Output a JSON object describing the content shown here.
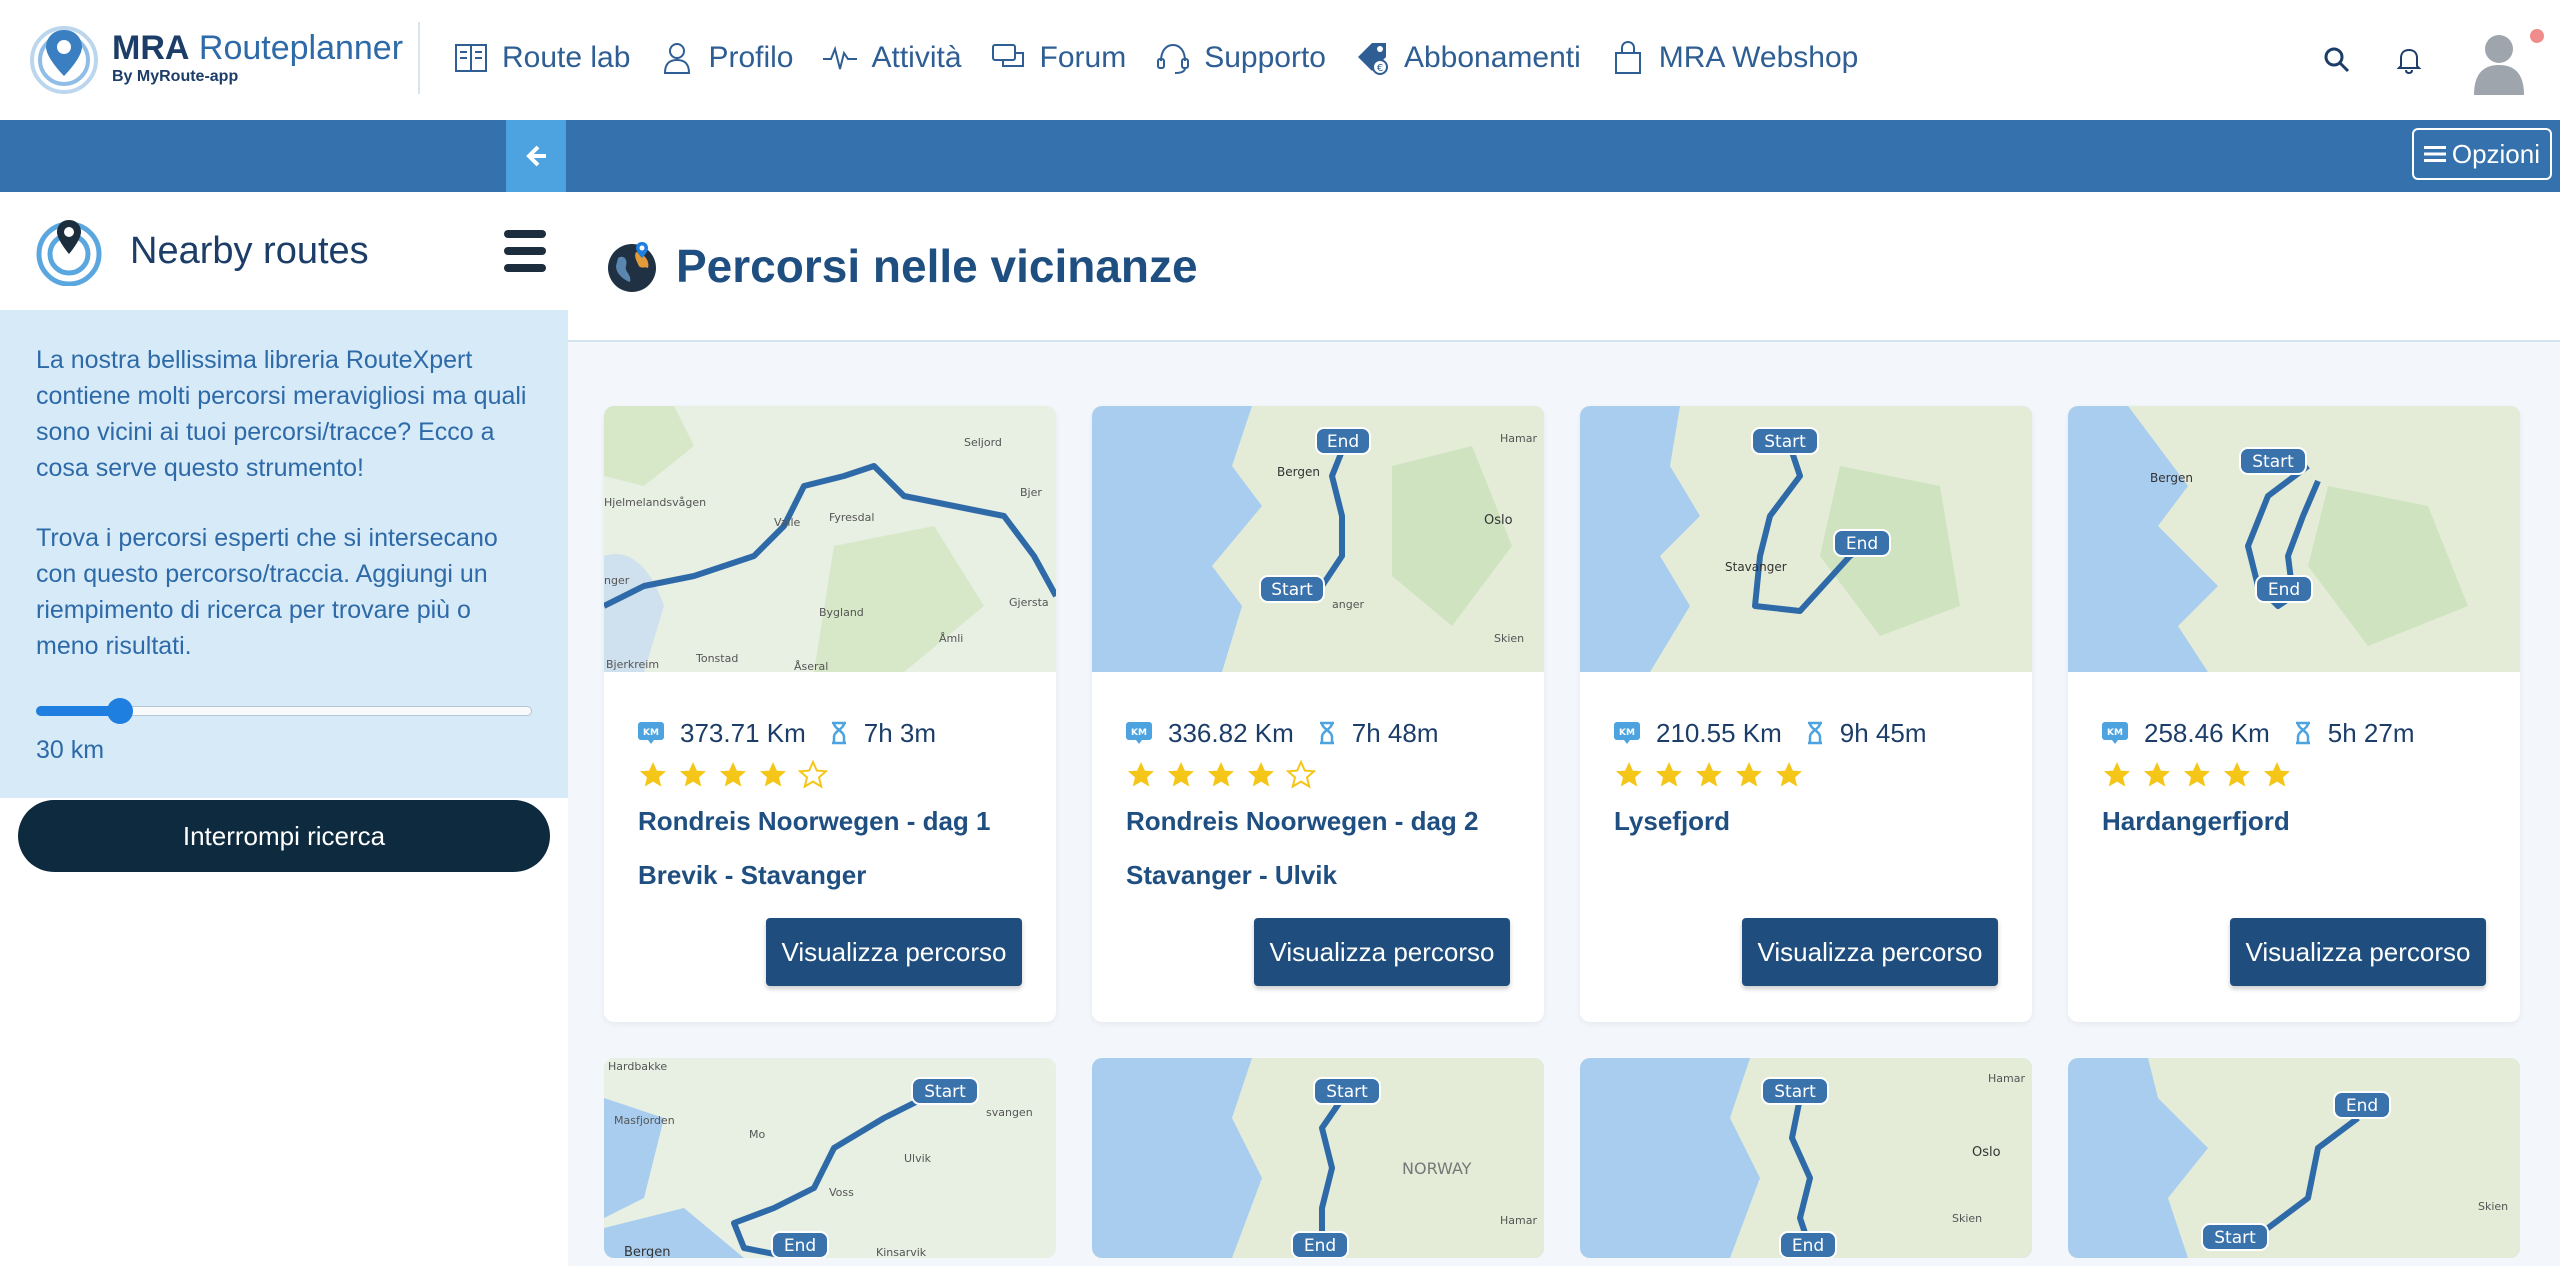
{
  "brand": {
    "name_bold": "MRA",
    "name_rest": " Routeplanner",
    "sub_prefix": "By MyRoute-",
    "sub_bold": "app"
  },
  "nav": [
    {
      "label": "Route lab",
      "icon": "map-book-icon"
    },
    {
      "label": "Profilo",
      "icon": "user-icon"
    },
    {
      "label": "Attività",
      "icon": "pulse-icon"
    },
    {
      "label": "Forum",
      "icon": "chat-icon"
    },
    {
      "label": "Supporto",
      "icon": "headset-icon"
    },
    {
      "label": "Abbonamenti",
      "icon": "tag-icon"
    },
    {
      "label": "MRA Webshop",
      "icon": "shopping-bag-icon"
    }
  ],
  "toolbar": {
    "options_label": "Opzioni"
  },
  "sidebar": {
    "title": "Nearby routes",
    "paragraph1": "La nostra bellissima libreria RouteXpert contiene molti percorsi meravigliosi ma quali sono vicini ai tuoi percorsi/tracce? Ecco a cosa serve questo strumento!",
    "paragraph2": "Trova i percorsi esperti che si intersecano con questo percorso/traccia. Aggiungi un riempimento di ricerca per trovare più o meno risultati.",
    "slider_value_label": "30 km",
    "slider_fraction": 0.17,
    "stop_button": "Interrompi ricerca"
  },
  "main": {
    "title": "Percorsi nelle vicinanze",
    "view_button": "Visualizza percorso"
  },
  "routes": [
    {
      "distance": "373.71 Km",
      "duration": "7h 3m",
      "rating": 4,
      "name1": "Rondreis Noorwegen - dag 1",
      "name2": "Brevik - Stavanger",
      "map_labels": [
        "Seljord",
        "Hjelmelandsvågen",
        "Valle",
        "Fyresdal",
        "Bjer",
        "Bygland",
        "Gjersta",
        "Åmli",
        "Bjerkreim",
        "Tonstad",
        "Åseral",
        "nger"
      ]
    },
    {
      "distance": "336.82 Km",
      "duration": "7h 48m",
      "rating": 4,
      "name1": "Rondreis Noorwegen - dag 2",
      "name2": "Stavanger - Ulvik",
      "map_labels": [
        "Bergen",
        "Hamar",
        "Oslo",
        "anger",
        "Skien"
      ],
      "start": "Start",
      "end": "End"
    },
    {
      "distance": "210.55 Km",
      "duration": "9h 45m",
      "rating": 5,
      "name1": "Lysefjord",
      "name2": "",
      "map_labels": [
        "Stavanger"
      ],
      "start": "Start",
      "end": "End"
    },
    {
      "distance": "258.46 Km",
      "duration": "5h 27m",
      "rating": 5,
      "name1": "Hardangerfjord",
      "name2": "",
      "map_labels": [
        "Bergen"
      ],
      "start": "Start",
      "end": "End"
    }
  ],
  "routes_row2": [
    {
      "map_labels": [
        "Hardbakke",
        "Masfjorden",
        "Mo",
        "Voss",
        "Ulvik",
        "Bergen",
        "Kinsarvik",
        "svangen"
      ],
      "start": "Start",
      "end": "End"
    },
    {
      "map_labels": [
        "NORWAY",
        "Hamar"
      ],
      "start": "Start",
      "end": "End"
    },
    {
      "map_labels": [
        "Hamar",
        "Oslo",
        "Skien"
      ],
      "start": "Start",
      "end": "End"
    },
    {
      "map_labels": [
        "Skien"
      ],
      "start": "Start",
      "end": "End"
    }
  ],
  "colors": {
    "accent": "#3572ad",
    "dark_button": "#1f4e7e",
    "star": "#f5c518"
  }
}
